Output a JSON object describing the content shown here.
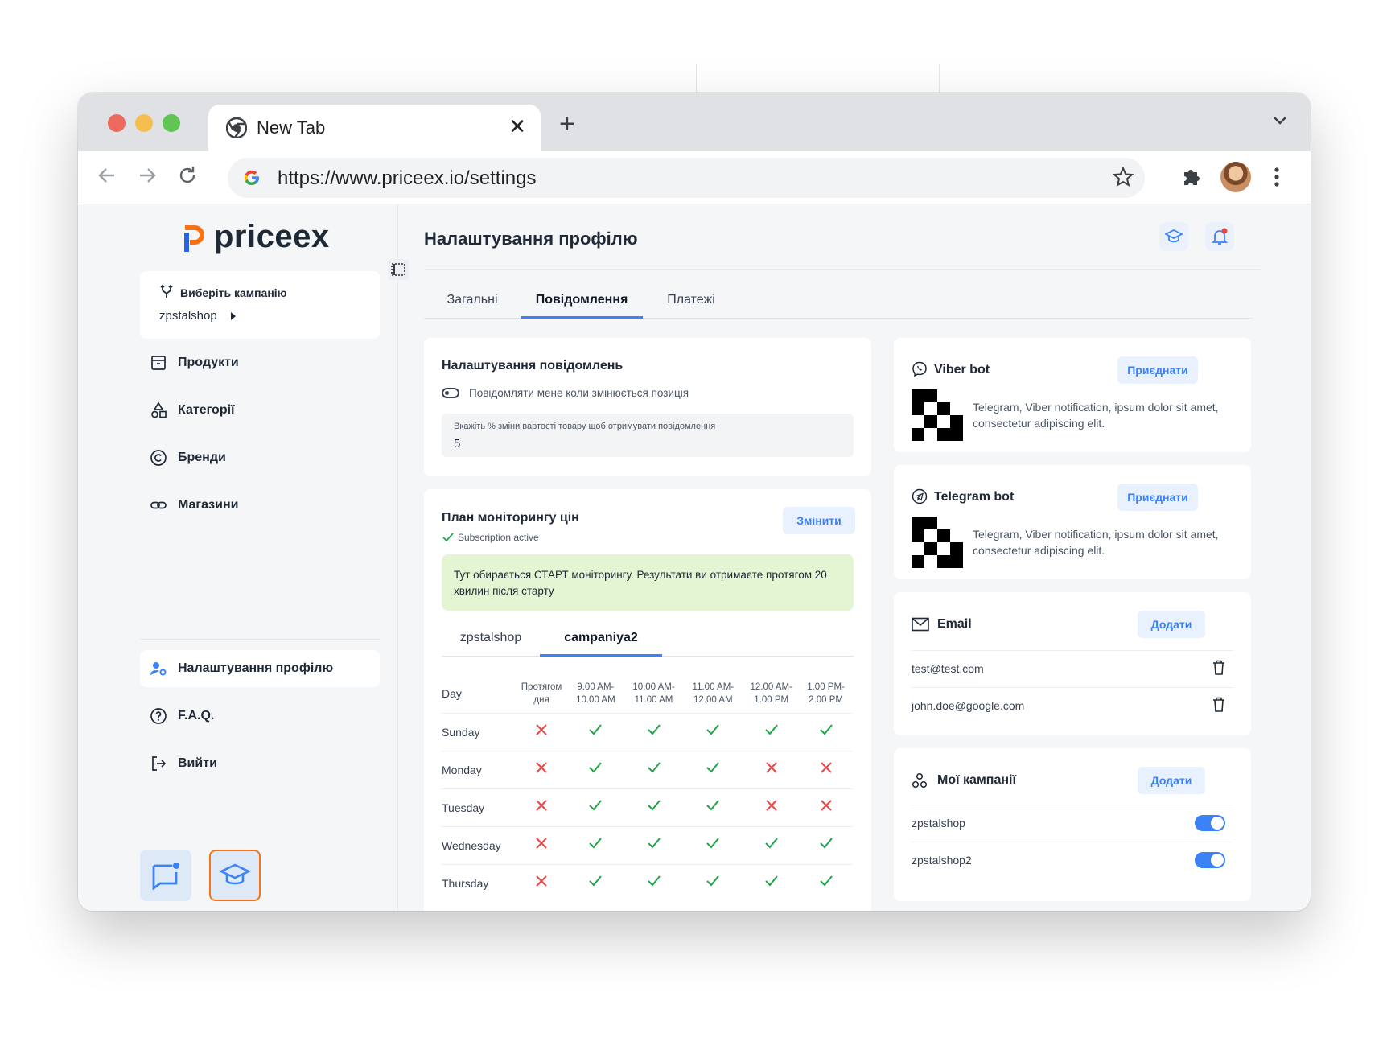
{
  "browser": {
    "tab_title": "New Tab",
    "url": "https://www.priceex.io/settings"
  },
  "sidebar": {
    "logo_text": "priceex",
    "campaign_label": "Виберіть кампанію",
    "campaign_value": "zpstalshop",
    "items": [
      {
        "label": "Продукти",
        "icon": "archive-icon"
      },
      {
        "label": "Категорії",
        "icon": "shapes-icon"
      },
      {
        "label": "Бренди",
        "icon": "copyright-icon"
      },
      {
        "label": "Магазини",
        "icon": "link-icon"
      },
      {
        "label": "Налаштування профілю",
        "icon": "user-settings-icon",
        "active": true
      },
      {
        "label": "F.A.Q.",
        "icon": "help-circle-icon"
      },
      {
        "label": "Вийти",
        "icon": "logout-icon"
      }
    ]
  },
  "header": {
    "title": "Налаштування профілю"
  },
  "tabs": [
    "Загальні",
    "Повідомлення",
    "Платежі"
  ],
  "active_tab": "Повідомлення",
  "notifications": {
    "title": "Налаштування повідомлень",
    "toggle_label": "Повідомляти мене коли змінюється позиція",
    "input_label": "Вкажіть % зміни вартості товару щоб отримувати повідомлення",
    "input_value": "5"
  },
  "plan": {
    "title": "План моніторингу цін",
    "change_button": "Змінити",
    "status": "Subscription active",
    "notice": "Тут обирається СТАРТ моніторингу. Результати ви отримаєте протягом 20 хвилин після старту",
    "campaign_tabs": [
      "zpstalshop",
      "campaniya2"
    ],
    "active_campaign_tab": "campaniya2",
    "columns": [
      "Day",
      "Протягом дня",
      "9.00 AM- 10.00 AM",
      "10.00 AM- 11.00 AM",
      "11.00 AM- 12.00 AM",
      "12.00 AM- 1.00 PM",
      "1.00 PM- 2.00 PM"
    ],
    "rows": [
      {
        "day": "Sunday",
        "values": [
          false,
          true,
          true,
          true,
          true,
          true
        ]
      },
      {
        "day": "Monday",
        "values": [
          false,
          true,
          true,
          true,
          false,
          false
        ]
      },
      {
        "day": "Tuesday",
        "values": [
          false,
          true,
          true,
          true,
          false,
          false
        ]
      },
      {
        "day": "Wednesday",
        "values": [
          false,
          true,
          true,
          true,
          true,
          true
        ]
      },
      {
        "day": "Thursday",
        "values": [
          false,
          true,
          true,
          true,
          true,
          true
        ]
      }
    ]
  },
  "viber": {
    "title": "Viber bot",
    "button": "Приєднати",
    "description": "Telegram, Viber notification, ipsum dolor sit amet, consectetur adipiscing elit."
  },
  "telegram": {
    "title": "Telegram bot",
    "button": "Приєднати",
    "description": "Telegram, Viber notification, ipsum dolor sit amet, consectetur adipiscing elit."
  },
  "email": {
    "title": "Email",
    "button": "Додати",
    "items": [
      "test@test.com",
      "john.doe@google.com"
    ]
  },
  "campaigns": {
    "title": "Мої кампанії",
    "button": "Додати",
    "items": [
      {
        "name": "zpstalshop",
        "enabled": true
      },
      {
        "name": "zpstalshop2",
        "enabled": true
      }
    ]
  },
  "colors": {
    "accent": "#3b82f6",
    "success": "#22a34a",
    "danger": "#ef4444",
    "notice_bg": "#e3f5d3",
    "logo_orange": "#f97316"
  }
}
